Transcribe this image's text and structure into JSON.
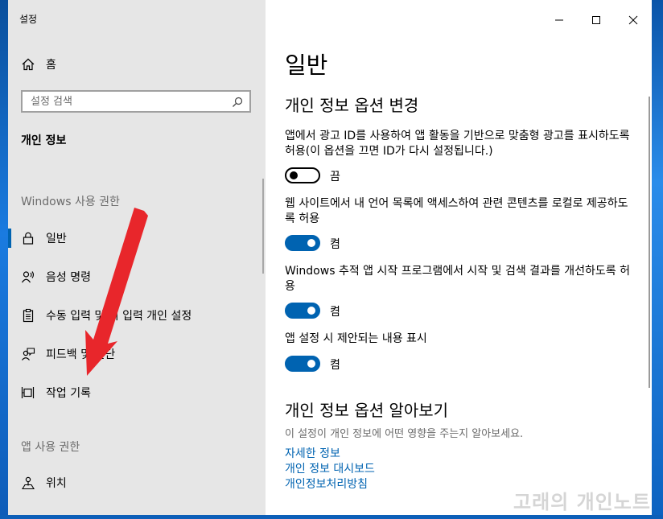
{
  "window": {
    "app_title": "설정",
    "controls": {
      "minimize": "minimize",
      "maximize": "maximize",
      "close": "close"
    }
  },
  "sidebar": {
    "home_label": "홈",
    "search_placeholder": "설정 검색",
    "section_title": "개인 정보",
    "windows_group": {
      "title": "Windows 사용 권한",
      "items": [
        {
          "label": "일반",
          "icon": "lock-icon",
          "active": true
        },
        {
          "label": "음성 명령",
          "icon": "voice-icon",
          "active": false
        },
        {
          "label": "수동 입력 및 키 입력 개인 설정",
          "icon": "clipboard-icon",
          "active": false
        },
        {
          "label": "피드백 및 진단",
          "icon": "feedback-icon",
          "active": false
        },
        {
          "label": "작업 기록",
          "icon": "timeline-icon",
          "active": false
        }
      ]
    },
    "app_group": {
      "title": "앱 사용 권한",
      "items": [
        {
          "label": "위치",
          "icon": "location-icon",
          "active": false
        }
      ]
    }
  },
  "content": {
    "page_title": "일반",
    "change_section_title": "개인 정보 옵션 변경",
    "options": [
      {
        "description": "앱에서 광고 ID를 사용하여 앱 활동을 기반으로 맞춤형 광고를 표시하도록 허용(이 옵션을 끄면 ID가 다시 설정됩니다.)",
        "state": "끔",
        "on": false
      },
      {
        "description": "웹 사이트에서 내 언어 목록에 액세스하여 관련 콘텐츠를 로컬로 제공하도록 허용",
        "state": "켬",
        "on": true
      },
      {
        "description": "Windows 추적 앱 시작 프로그램에서 시작 및 검색 결과를 개선하도록 허용",
        "state": "켬",
        "on": true
      },
      {
        "description": "앱 설정 시 제안되는 내용 표시",
        "state": "켬",
        "on": true
      }
    ],
    "learn_section_title": "개인 정보 옵션 알아보기",
    "learn_description": "이 설정이 개인 정보에 어떤 영향을 주는지 알아보세요.",
    "links": [
      "자세한 정보",
      "개인 정보 대시보드",
      "개인정보처리방침"
    ]
  },
  "watermark": "고래의 개인노트",
  "colors": {
    "accent": "#0063b1",
    "sidebar_bg": "#e6e6e6",
    "annotation_arrow": "#e8262b"
  }
}
